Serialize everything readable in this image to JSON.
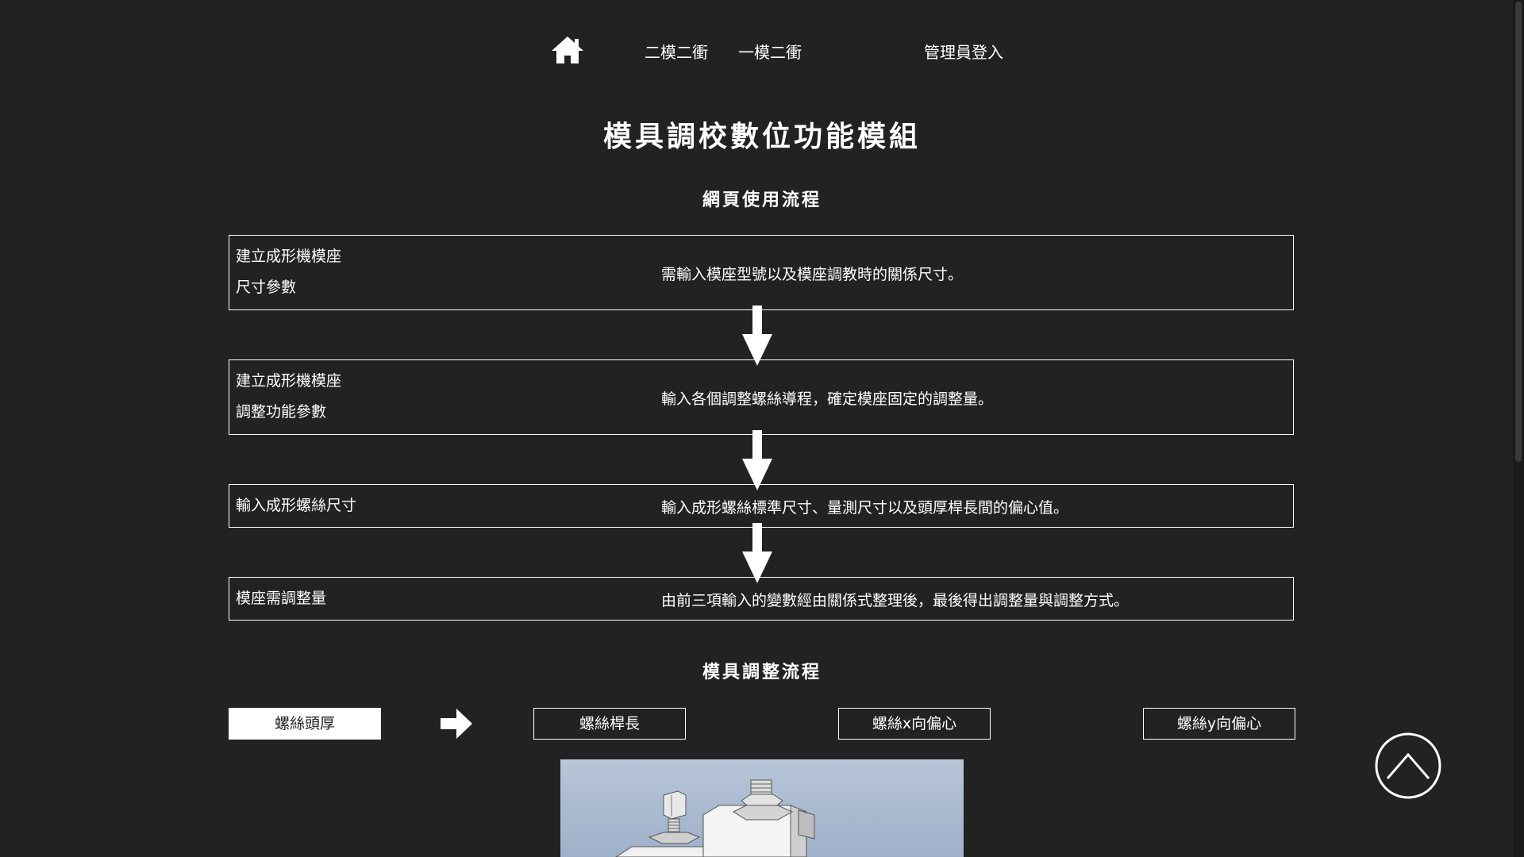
{
  "nav": {
    "home_icon": "home-icon",
    "links": [
      "二模二衝",
      "一模二衝"
    ],
    "admin_login": "管理員登入"
  },
  "main_title": "模具調校數位功能模組",
  "flow_section_title": "網頁使用流程",
  "flow_steps": [
    {
      "label_lines": [
        "建立成形機模座",
        "尺寸參數"
      ],
      "desc": "需輸入模座型號以及模座調教時的關係尺寸。"
    },
    {
      "label_lines": [
        "建立成形機模座",
        "調整功能參數"
      ],
      "desc": "輸入各個調整螺絲導程，確定模座固定的調整量。"
    },
    {
      "label_lines": [
        "輸入成形螺絲尺寸"
      ],
      "desc": "輸入成形螺絲標準尺寸、量測尺寸以及頭厚桿長間的偏心值。"
    },
    {
      "label_lines": [
        "模座需調整量"
      ],
      "desc": "由前三項輸入的變數經由關係式整理後，最後得出調整量與調整方式。"
    }
  ],
  "adjust_section_title": "模具調整流程",
  "adjust_tabs": [
    {
      "label": "螺絲頭厚",
      "active": true
    },
    {
      "label": "螺絲桿長",
      "active": false
    },
    {
      "label": "螺絲x向偏心",
      "active": false
    },
    {
      "label": "螺絲y向偏心",
      "active": false
    }
  ],
  "colors": {
    "background": "#222222",
    "foreground": "#ffffff"
  },
  "icons": {
    "arrow_down": "arrow-down-icon",
    "arrow_right": "arrow-right-icon",
    "back_to_top": "chevron-up-circle-icon"
  }
}
